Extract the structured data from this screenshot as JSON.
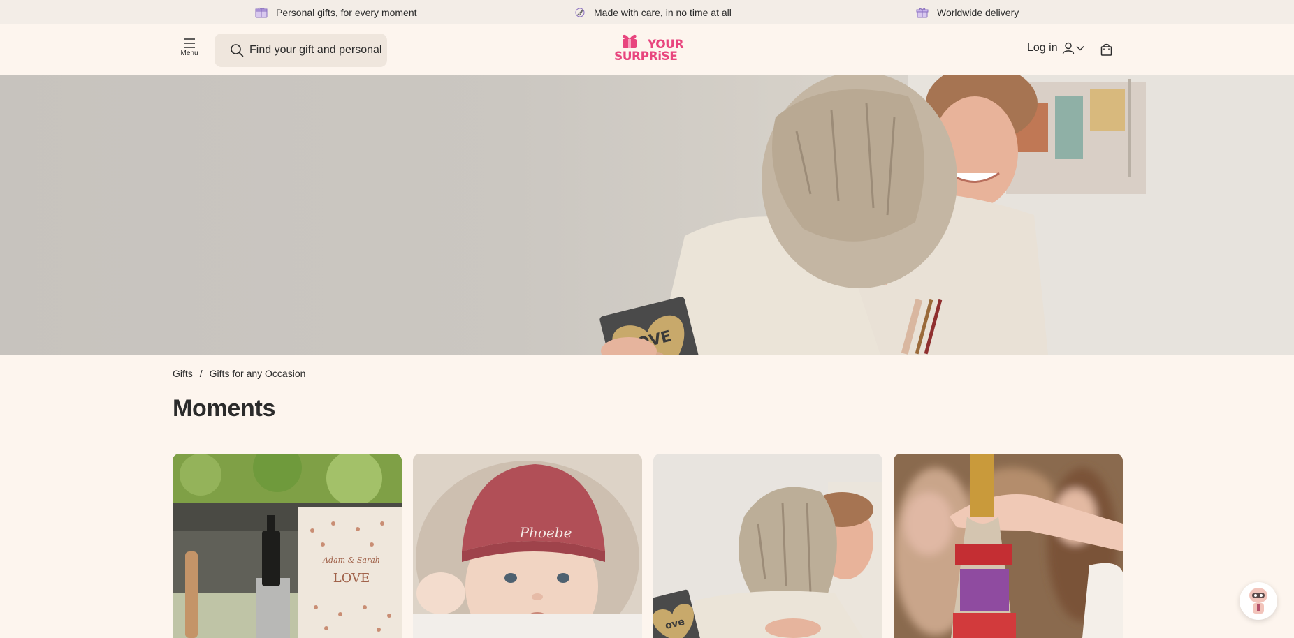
{
  "usp": {
    "item1": "Personal gifts, for every moment",
    "item2": "Made with care, in no time at all",
    "item3": "Worldwide delivery"
  },
  "header": {
    "menu_label": "Menu",
    "search_placeholder": "Find your gift and personalise it",
    "logo_line1": "YOUR",
    "logo_line2": "SURPRiSE",
    "login_label": "Log in"
  },
  "hero": {
    "tile_text": "LOVE"
  },
  "breadcrumb": {
    "items": [
      "Gifts",
      "Gifts for any Occasion"
    ],
    "separator": "/"
  },
  "page": {
    "title": "Moments"
  },
  "cards": [
    {
      "image": "wine-bottle-and-love-book",
      "book_text_1": "Adam & Sarah",
      "book_text_2": "LOVE"
    },
    {
      "image": "baby-with-personalised-beanie",
      "beanie_text": "Phoebe"
    },
    {
      "image": "hug-with-love-photo-tile",
      "tile_text": "ove"
    },
    {
      "image": "personalised-champagne-bottle"
    }
  ],
  "colors": {
    "brand_pink": "#e8457e",
    "background": "#fdf5ee",
    "usp_bar": "#f3ede7",
    "search_bg": "#efe6dd",
    "text": "#2b2b2b"
  },
  "icons": {
    "usp1": "gift-box-icon",
    "usp2": "leaf-pen-icon",
    "usp3": "delivery-gift-icon",
    "menu": "hamburger-icon",
    "search": "search-icon",
    "account": "user-icon",
    "account_dropdown": "chevron-down-icon",
    "cart": "shopping-bag-icon",
    "chat": "robot-chat-icon"
  }
}
